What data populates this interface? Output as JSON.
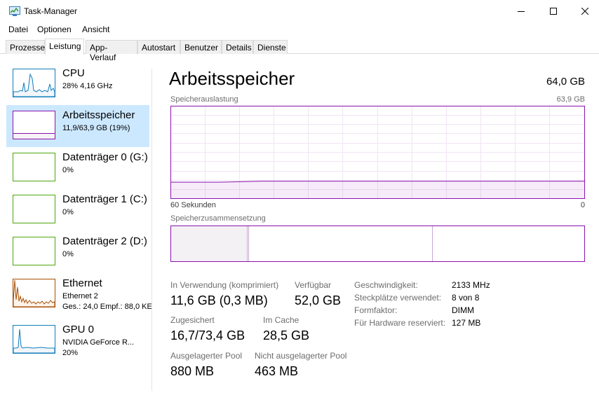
{
  "window": {
    "title": "Task-Manager",
    "icon": "task-manager-icon",
    "buttons": [
      "minimize-icon",
      "maximize-icon",
      "close-icon"
    ]
  },
  "menu": [
    "Datei",
    "Optionen",
    "Ansicht"
  ],
  "tabs": [
    "Prozesse",
    "Leistung",
    "App-Verlauf",
    "Autostart",
    "Benutzer",
    "Details",
    "Dienste"
  ],
  "active_tab": "Leistung",
  "sidebar": [
    {
      "name": "CPU",
      "line1": "28%  4,16 GHz",
      "line2": "",
      "color": "#117dbb"
    },
    {
      "name": "Arbeitsspeicher",
      "line1": "11,9/63,9 GB (19%)",
      "line2": "",
      "color": "#8b12ae"
    },
    {
      "name": "Datenträger 0 (G:)",
      "line1": "0%",
      "line2": "",
      "color": "#4da60c"
    },
    {
      "name": "Datenträger 1 (C:)",
      "line1": "0%",
      "line2": "",
      "color": "#4da60c"
    },
    {
      "name": "Datenträger 2 (D:)",
      "line1": "0%",
      "line2": "",
      "color": "#4da60c"
    },
    {
      "name": "Ethernet",
      "line1": "Ethernet 2",
      "line2": "Ges.: 24,0  Empf.: 88,0 KE",
      "color": "#a74f01"
    },
    {
      "name": "GPU 0",
      "line1": "NVIDIA GeForce R...",
      "line2": "20%",
      "color": "#117dbb"
    }
  ],
  "selected_item": "Arbeitsspeicher",
  "main": {
    "title": "Arbeitsspeicher",
    "capacity": "64,0 GB",
    "usage_graph_label": "Speicherauslastung",
    "usage_graph_max": "63,9 GB",
    "time_left": "60 Sekunden",
    "time_right": "0",
    "composition_label": "Speicherzusammensetzung",
    "usage_fraction": 0.19,
    "accent": "#8b12ae",
    "stats": {
      "in_use_label": "In Verwendung (komprimiert)",
      "in_use_value": "11,6 GB (0,3 MB)",
      "available_label": "Verfügbar",
      "available_value": "52,0 GB",
      "committed_label": "Zugesichert",
      "committed_value": "16,7/73,4 GB",
      "cached_label": "Im Cache",
      "cached_value": "28,5 GB",
      "paged_label": "Ausgelagerter Pool",
      "paged_value": "880 MB",
      "nonpaged_label": "Nicht ausgelagerter Pool",
      "nonpaged_value": "463 MB"
    },
    "details": [
      {
        "label": "Geschwindigkeit:",
        "value": "2133 MHz"
      },
      {
        "label": "Steckplätze verwendet:",
        "value": "8 von 8"
      },
      {
        "label": "Formfaktor:",
        "value": "DIMM"
      },
      {
        "label": "Für Hardware reserviert:",
        "value": "127 MB"
      }
    ]
  }
}
